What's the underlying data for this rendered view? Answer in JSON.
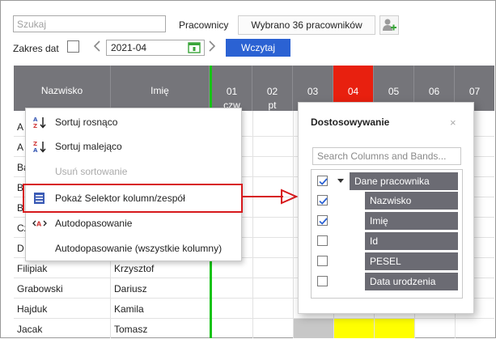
{
  "toolbar": {
    "search_placeholder": "Szukaj",
    "employees_label": "Pracownicy",
    "employees_button": "Wybrano 36 pracowników",
    "date_range_label": "Zakres dat",
    "date_value": "2021-04",
    "load_button": "Wczytaj"
  },
  "grid": {
    "columns": {
      "surname": "Nazwisko",
      "first_name": "Imię"
    },
    "days": [
      {
        "num": "01",
        "dow": "czw"
      },
      {
        "num": "02",
        "dow": "pt"
      },
      {
        "num": "03",
        "dow": ""
      },
      {
        "num": "04",
        "dow": ""
      },
      {
        "num": "05",
        "dow": ""
      },
      {
        "num": "06",
        "dow": ""
      },
      {
        "num": "07",
        "dow": ""
      }
    ],
    "rows": [
      {
        "surname": "A",
        "first_name": ""
      },
      {
        "surname": "A",
        "first_name": ""
      },
      {
        "surname": "Ba",
        "first_name": ""
      },
      {
        "surname": "B",
        "first_name": ""
      },
      {
        "surname": "B",
        "first_name": ""
      },
      {
        "surname": "Cz",
        "first_name": ""
      },
      {
        "surname": "D",
        "first_name": ""
      },
      {
        "surname": "Filipiak",
        "first_name": "Krzysztof"
      },
      {
        "surname": "Grabowski",
        "first_name": "Dariusz"
      },
      {
        "surname": "Hajduk",
        "first_name": "Kamila"
      },
      {
        "surname": "Jacak",
        "first_name": "Tomasz"
      }
    ]
  },
  "context_menu": {
    "sort_asc": "Sortuj rosnąco",
    "sort_desc": "Sortuj malejąco",
    "clear_sort": "Usuń sortowanie",
    "column_chooser": "Pokaż Selektor kolumn/zespół",
    "best_fit": "Autodopasowanie",
    "best_fit_all": "Autodopasowanie (wszystkie kolumny)"
  },
  "customization": {
    "title": "Dostosowywanie",
    "close_symbol": "×",
    "search_placeholder": "Search Columns and Bands...",
    "items": [
      {
        "label": "Dane pracownika",
        "checked": true
      },
      {
        "label": "Nazwisko",
        "checked": true
      },
      {
        "label": "Imię",
        "checked": true
      },
      {
        "label": "Id",
        "checked": false
      },
      {
        "label": "PESEL",
        "checked": false
      },
      {
        "label": "Data urodzenia",
        "checked": false
      }
    ]
  },
  "colors": {
    "accent_blue": "#2b62d3",
    "header_gray": "#75757a",
    "today_red": "#e8200f",
    "highlight_red": "#d7191c",
    "marker_green": "#16c316",
    "weekend_yellow": "#ffff00"
  },
  "icons": {
    "add_user": "add-user-icon",
    "calendar": "calendar-icon",
    "sort_asc": "sort-ascending-icon",
    "sort_desc": "sort-descending-icon",
    "column_chooser": "column-chooser-icon",
    "best_fit": "best-fit-icon"
  }
}
